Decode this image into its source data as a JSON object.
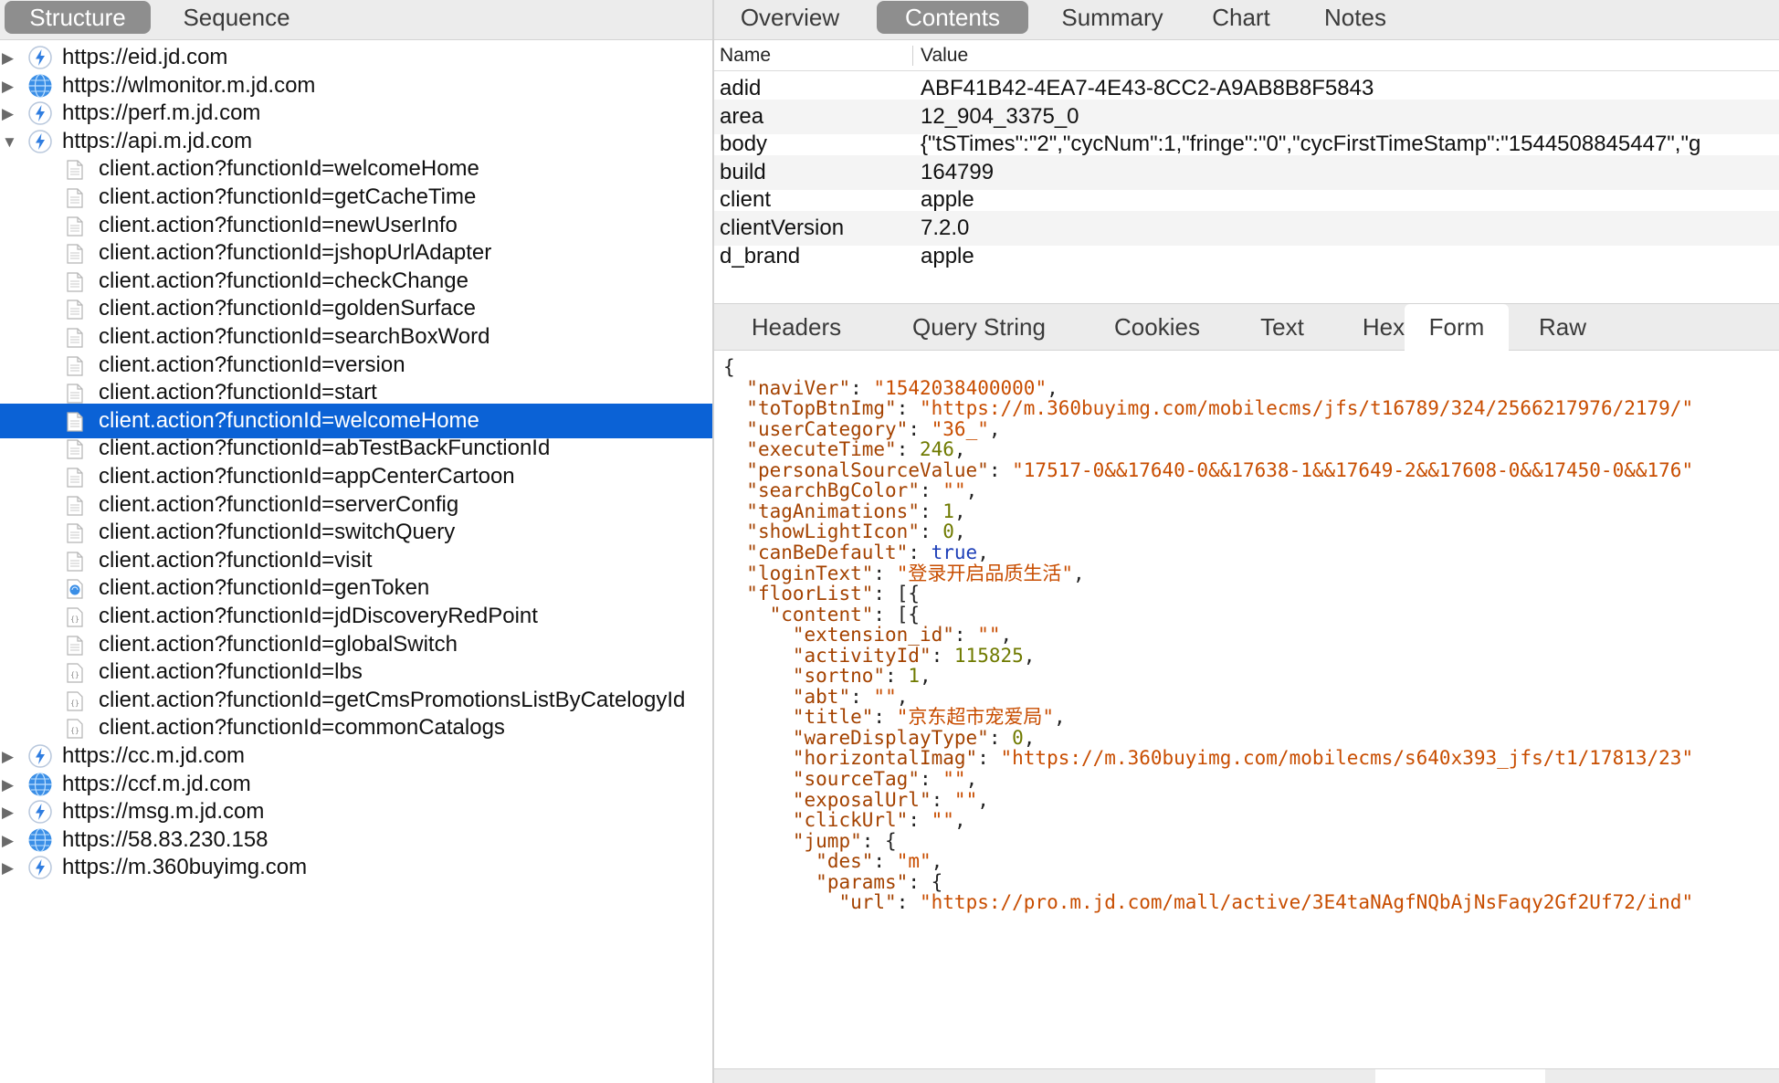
{
  "left_tabs": [
    {
      "label": "Structure",
      "active": true
    },
    {
      "label": "Sequence",
      "active": false
    }
  ],
  "tree": [
    {
      "label": "https://eid.jd.com",
      "level": 0,
      "icon": "bolt-icon",
      "expanded": false
    },
    {
      "label": "https://wlmonitor.m.jd.com",
      "level": 0,
      "icon": "globe-icon",
      "expanded": false
    },
    {
      "label": "https://perf.m.jd.com",
      "level": 0,
      "icon": "bolt-icon",
      "expanded": false
    },
    {
      "label": "https://api.m.jd.com",
      "level": 0,
      "icon": "bolt-icon",
      "expanded": true
    },
    {
      "label": "client.action?functionId=welcomeHome",
      "level": 1,
      "icon": "document-icon"
    },
    {
      "label": "client.action?functionId=getCacheTime",
      "level": 1,
      "icon": "document-icon"
    },
    {
      "label": "client.action?functionId=newUserInfo",
      "level": 1,
      "icon": "document-icon"
    },
    {
      "label": "client.action?functionId=jshopUrlAdapter",
      "level": 1,
      "icon": "document-icon"
    },
    {
      "label": "client.action?functionId=checkChange",
      "level": 1,
      "icon": "document-icon"
    },
    {
      "label": "client.action?functionId=goldenSurface",
      "level": 1,
      "icon": "document-icon"
    },
    {
      "label": "client.action?functionId=searchBoxWord",
      "level": 1,
      "icon": "document-icon"
    },
    {
      "label": "client.action?functionId=version",
      "level": 1,
      "icon": "document-icon"
    },
    {
      "label": "client.action?functionId=start",
      "level": 1,
      "icon": "document-icon"
    },
    {
      "label": "client.action?functionId=welcomeHome",
      "level": 1,
      "icon": "document-icon",
      "selected": true
    },
    {
      "label": "client.action?functionId=abTestBackFunctionId",
      "level": 1,
      "icon": "document-icon"
    },
    {
      "label": "client.action?functionId=appCenterCartoon",
      "level": 1,
      "icon": "document-icon"
    },
    {
      "label": "client.action?functionId=serverConfig",
      "level": 1,
      "icon": "document-icon"
    },
    {
      "label": "client.action?functionId=switchQuery",
      "level": 1,
      "icon": "document-icon"
    },
    {
      "label": "client.action?functionId=visit",
      "level": 1,
      "icon": "document-icon"
    },
    {
      "label": "client.action?functionId=genToken",
      "level": 1,
      "icon": "image-file-icon"
    },
    {
      "label": "client.action?functionId=jdDiscoveryRedPoint",
      "level": 1,
      "icon": "json-file-icon"
    },
    {
      "label": "client.action?functionId=globalSwitch",
      "level": 1,
      "icon": "document-icon"
    },
    {
      "label": "client.action?functionId=lbs",
      "level": 1,
      "icon": "json-file-icon"
    },
    {
      "label": "client.action?functionId=getCmsPromotionsListByCatelogyId",
      "level": 1,
      "icon": "json-file-icon"
    },
    {
      "label": "client.action?functionId=commonCatalogs",
      "level": 1,
      "icon": "json-file-icon"
    },
    {
      "label": "https://cc.m.jd.com",
      "level": 0,
      "icon": "bolt-icon",
      "expanded": false
    },
    {
      "label": "https://ccf.m.jd.com",
      "level": 0,
      "icon": "globe-icon",
      "expanded": false
    },
    {
      "label": "https://msg.m.jd.com",
      "level": 0,
      "icon": "bolt-icon",
      "expanded": false
    },
    {
      "label": "https://58.83.230.158",
      "level": 0,
      "icon": "globe-icon",
      "expanded": false
    },
    {
      "label": "https://m.360buyimg.com",
      "level": 0,
      "icon": "bolt-icon",
      "expanded": false
    }
  ],
  "top_tabs": [
    {
      "label": "Overview",
      "active": false
    },
    {
      "label": "Contents",
      "active": true
    },
    {
      "label": "Summary",
      "active": false
    },
    {
      "label": "Chart",
      "active": false
    },
    {
      "label": "Notes",
      "active": false
    }
  ],
  "kv_table": {
    "name_header": "Name",
    "value_header": "Value",
    "rows": [
      {
        "name": "adid",
        "value": "ABF41B42-4EA7-4E43-8CC2-A9AB8B8F5843"
      },
      {
        "name": "area",
        "value": "12_904_3375_0"
      },
      {
        "name": "body",
        "value": "{\"tSTimes\":\"2\",\"cycNum\":1,\"fringe\":\"0\",\"cycFirstTimeStamp\":\"1544508845447\",\"g"
      },
      {
        "name": "build",
        "value": "164799"
      },
      {
        "name": "client",
        "value": "apple"
      },
      {
        "name": "clientVersion",
        "value": "7.2.0"
      },
      {
        "name": "d_brand",
        "value": "apple"
      }
    ]
  },
  "sub_tabs": [
    {
      "label": "Headers",
      "active": false
    },
    {
      "label": "Query String",
      "active": false
    },
    {
      "label": "Cookies",
      "active": false
    },
    {
      "label": "Text",
      "active": false
    },
    {
      "label": "Hex",
      "active": false
    },
    {
      "label": "Form",
      "active": true
    },
    {
      "label": "Raw",
      "active": false
    }
  ],
  "code_lines": [
    {
      "indent": 0,
      "open": "{"
    },
    {
      "indent": 1,
      "key": "naviVer",
      "type": "str",
      "value": "1542038400000",
      "tail": ","
    },
    {
      "indent": 1,
      "key": "toTopBtnImg",
      "type": "str",
      "value": "https://m.360buyimg.com/mobilecms/jfs/t16789/324/2566217976/2179/",
      "tail": ""
    },
    {
      "indent": 1,
      "key": "userCategory",
      "type": "str",
      "value": "36_",
      "tail": ","
    },
    {
      "indent": 1,
      "key": "executeTime",
      "type": "num",
      "value": "246",
      "tail": ","
    },
    {
      "indent": 1,
      "key": "personalSourceValue",
      "type": "str",
      "value": "17517-0&&17640-0&&17638-1&&17649-2&&17608-0&&17450-0&&176",
      "tail": ""
    },
    {
      "indent": 1,
      "key": "searchBgColor",
      "type": "str",
      "value": "",
      "tail": ","
    },
    {
      "indent": 1,
      "key": "tagAnimations",
      "type": "num",
      "value": "1",
      "tail": ","
    },
    {
      "indent": 1,
      "key": "showLightIcon",
      "type": "num",
      "value": "0",
      "tail": ","
    },
    {
      "indent": 1,
      "key": "canBeDefault",
      "type": "bool",
      "value": "true",
      "tail": ","
    },
    {
      "indent": 1,
      "key": "loginText",
      "type": "str",
      "value": "登录开启品质生活",
      "tail": ","
    },
    {
      "indent": 1,
      "key": "floorList",
      "type": "open",
      "value": "[{",
      "tail": ""
    },
    {
      "indent": 2,
      "key": "content",
      "type": "open",
      "value": "[{",
      "tail": ""
    },
    {
      "indent": 3,
      "key": "extension_id",
      "type": "str",
      "value": "",
      "tail": ","
    },
    {
      "indent": 3,
      "key": "activityId",
      "type": "num",
      "value": "115825",
      "tail": ","
    },
    {
      "indent": 3,
      "key": "sortno",
      "type": "num",
      "value": "1",
      "tail": ","
    },
    {
      "indent": 3,
      "key": "abt",
      "type": "str",
      "value": "",
      "tail": ","
    },
    {
      "indent": 3,
      "key": "title",
      "type": "str",
      "value": "京东超市宠爱局",
      "tail": ","
    },
    {
      "indent": 3,
      "key": "wareDisplayType",
      "type": "num",
      "value": "0",
      "tail": ","
    },
    {
      "indent": 3,
      "key": "horizontalImag",
      "type": "str",
      "value": "https://m.360buyimg.com/mobilecms/s640x393_jfs/t1/17813/23",
      "tail": ""
    },
    {
      "indent": 3,
      "key": "sourceTag",
      "type": "str",
      "value": "",
      "tail": ","
    },
    {
      "indent": 3,
      "key": "exposalUrl",
      "type": "str",
      "value": "",
      "tail": ","
    },
    {
      "indent": 3,
      "key": "clickUrl",
      "type": "str",
      "value": "",
      "tail": ","
    },
    {
      "indent": 3,
      "key": "jump",
      "type": "open",
      "value": "{",
      "tail": ""
    },
    {
      "indent": 4,
      "key": "des",
      "type": "str",
      "value": "m",
      "tail": ","
    },
    {
      "indent": 4,
      "key": "params",
      "type": "open",
      "value": "{",
      "tail": ""
    },
    {
      "indent": 5,
      "key": "url",
      "type": "str",
      "value": "https://pro.m.jd.com/mall/active/3E4taNAgfNQbAjNsFaqy2Gf2Uf72/ind",
      "tail": ""
    }
  ],
  "colors": {
    "selection": "#0b62d6",
    "json_key": "#a44200",
    "json_string": "#c84d00",
    "json_number": "#6f7a00",
    "json_bool": "#1d3fb8",
    "active_tab": "#8e8e8e"
  }
}
